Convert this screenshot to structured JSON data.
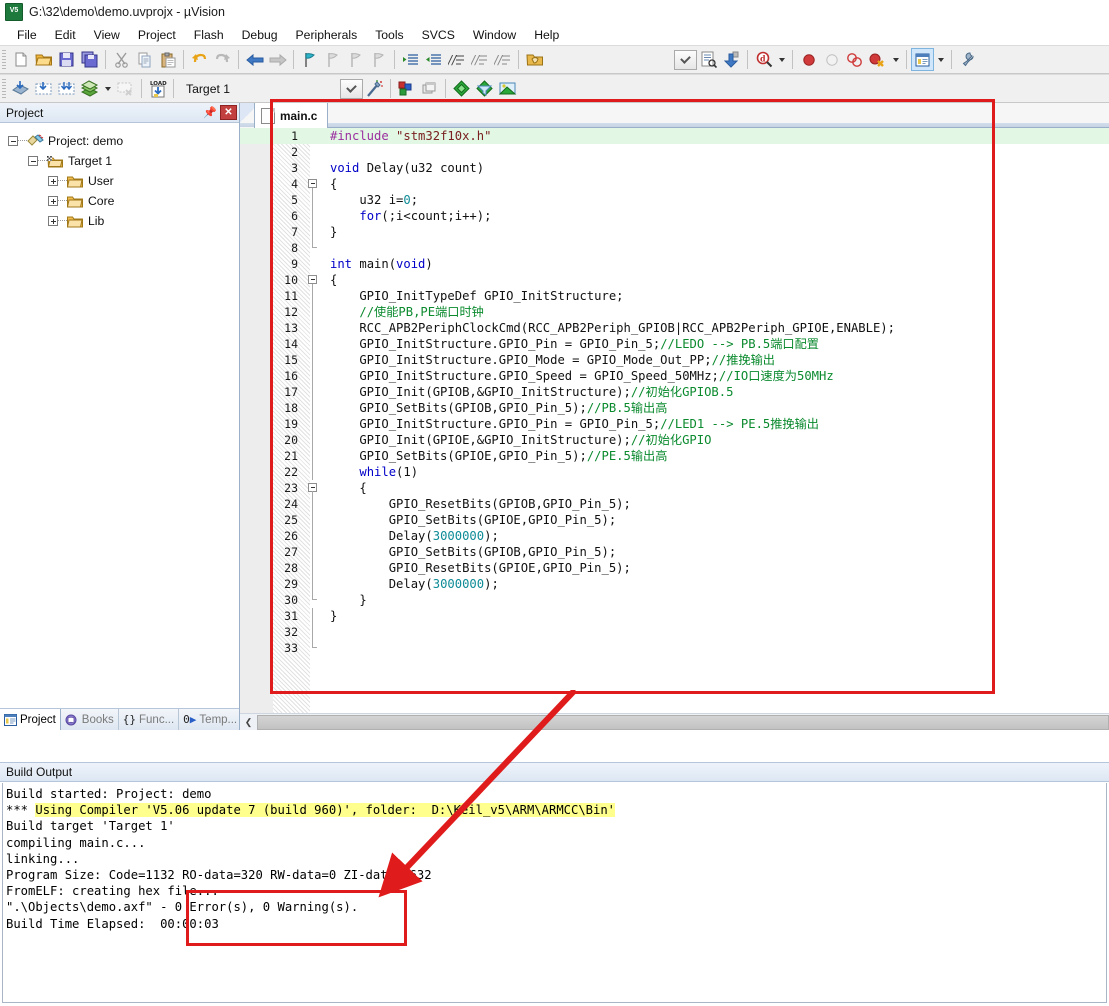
{
  "window": {
    "title": "G:\\32\\demo\\demo.uvprojx - µVision",
    "app_icon": "keil-uvision-icon"
  },
  "menubar": {
    "items": [
      "File",
      "Edit",
      "View",
      "Project",
      "Flash",
      "Debug",
      "Peripherals",
      "Tools",
      "SVCS",
      "Window",
      "Help"
    ]
  },
  "toolbar_row1": {
    "buttons": [
      {
        "name": "new-file-button",
        "icon": "new-document-icon"
      },
      {
        "name": "open-file-button",
        "icon": "open-folder-icon"
      },
      {
        "name": "save-button",
        "icon": "floppy-disk-icon"
      },
      {
        "name": "save-all-button",
        "icon": "save-all-icon"
      },
      {
        "name": "cut-button",
        "icon": "scissors-icon"
      },
      {
        "name": "copy-button",
        "icon": "copy-icon"
      },
      {
        "name": "paste-button",
        "icon": "clipboard-paste-icon"
      },
      {
        "name": "undo-button",
        "icon": "undo-arrow-icon"
      },
      {
        "name": "redo-button",
        "icon": "redo-arrow-icon"
      },
      {
        "name": "navigate-back-button",
        "icon": "arrow-left-icon"
      },
      {
        "name": "navigate-forward-button",
        "icon": "arrow-right-icon"
      },
      {
        "name": "toggle-bookmark-button",
        "icon": "bookmark-flag-icon"
      },
      {
        "name": "prev-bookmark-button",
        "icon": "bookmark-prev-icon"
      },
      {
        "name": "next-bookmark-button",
        "icon": "bookmark-next-icon"
      },
      {
        "name": "clear-bookmarks-button",
        "icon": "bookmark-clear-icon"
      },
      {
        "name": "indent-button",
        "icon": "indent-right-icon"
      },
      {
        "name": "outdent-button",
        "icon": "indent-left-icon"
      },
      {
        "name": "comment-button",
        "icon": "comment-lines-icon"
      },
      {
        "name": "uncomment-button",
        "icon": "uncomment-lines-icon"
      },
      {
        "name": "uncomment2-button",
        "icon": "uncomment-alt-icon"
      },
      {
        "name": "open-in-folder-button",
        "icon": "folder-hand-icon"
      },
      {
        "name": "config-combo-button",
        "icon": "chevron-down-icon"
      },
      {
        "name": "configure-debug-button",
        "icon": "document-settings-icon"
      },
      {
        "name": "download-button",
        "icon": "blue-down-arrow-icon"
      },
      {
        "name": "start-debug-button",
        "icon": "debug-magnifier-icon"
      },
      {
        "name": "start-debug-dropdown",
        "icon": "caret-down-icon"
      },
      {
        "name": "insert-breakpoint-button",
        "icon": "red-circle-icon"
      },
      {
        "name": "disable-breakpoint-button",
        "icon": "hollow-circle-icon"
      },
      {
        "name": "disable-all-breakpoints-button",
        "icon": "two-circles-icon"
      },
      {
        "name": "kill-all-breakpoints-button",
        "icon": "red-circle-x-icon"
      },
      {
        "name": "breakpoints-dropdown",
        "icon": "caret-down-icon"
      },
      {
        "name": "window-layout-button",
        "icon": "window-panes-icon"
      },
      {
        "name": "window-layout-dropdown",
        "icon": "caret-down-icon"
      },
      {
        "name": "configure-button",
        "icon": "wrench-icon"
      }
    ]
  },
  "toolbar_row2": {
    "buttons": [
      {
        "name": "translate-button",
        "icon": "translate-file-icon"
      },
      {
        "name": "build-button",
        "icon": "build-target-icon"
      },
      {
        "name": "rebuild-button",
        "icon": "rebuild-all-icon"
      },
      {
        "name": "batch-build-button",
        "icon": "batch-build-icon"
      },
      {
        "name": "batch-build-dropdown",
        "icon": "caret-down-icon"
      },
      {
        "name": "stop-build-button",
        "icon": "stop-build-icon"
      },
      {
        "name": "load-button",
        "icon": "load-download-icon"
      },
      {
        "name": "target-dropdown-button",
        "icon": "chevron-down-icon"
      },
      {
        "name": "target-options-button",
        "icon": "magic-wand-icon"
      },
      {
        "name": "manage-project-items-button",
        "icon": "project-items-icon"
      },
      {
        "name": "manage-multiproject-button",
        "icon": "multi-project-icon"
      },
      {
        "name": "pack-installer-button",
        "icon": "green-diamond-icon"
      },
      {
        "name": "manage-runtime-button",
        "icon": "filter-diamond-icon"
      },
      {
        "name": "select-software-packs-button",
        "icon": "packs-box-icon"
      }
    ],
    "target_label": "Target 1"
  },
  "project_panel": {
    "title": "Project",
    "pin_icon": "pin-icon",
    "close_icon": "close-x-icon",
    "tree": [
      {
        "label": "Project: demo",
        "icon": "project-root-icon",
        "depth": 0,
        "expander": "minus"
      },
      {
        "label": "Target 1",
        "icon": "target-icon",
        "depth": 1,
        "expander": "minus"
      },
      {
        "label": "User",
        "icon": "folder-icon",
        "depth": 2,
        "expander": "plus"
      },
      {
        "label": "Core",
        "icon": "folder-icon",
        "depth": 2,
        "expander": "plus"
      },
      {
        "label": "Lib",
        "icon": "folder-icon",
        "depth": 2,
        "expander": "plus"
      }
    ],
    "tabs": [
      {
        "label": "Project",
        "icon": "project-window-icon",
        "selected": true
      },
      {
        "label": "Books",
        "icon": "books-icon",
        "selected": false
      },
      {
        "label": "Func...",
        "icon": "functions-braces-icon",
        "selected": false
      },
      {
        "label": "Temp...",
        "icon": "templates-icon",
        "selected": false
      }
    ]
  },
  "editor": {
    "tab": {
      "label": "main.c",
      "icon": "c-file-icon"
    },
    "scroll_left_icon": "chevron-left-icon",
    "lines": [
      {
        "n": 1,
        "highlight": true,
        "fold": "none",
        "tokens": [
          {
            "t": "#include ",
            "c": "pp"
          },
          {
            "t": "\"stm32f10x.h\"",
            "c": "st"
          }
        ]
      },
      {
        "n": 2,
        "highlight": false,
        "fold": "none",
        "tokens": []
      },
      {
        "n": 3,
        "highlight": false,
        "fold": "none",
        "tokens": [
          {
            "t": "void",
            "c": "k"
          },
          {
            "t": " Delay(u32 count)",
            "c": "cn"
          }
        ]
      },
      {
        "n": 4,
        "highlight": false,
        "fold": "start",
        "tokens": [
          {
            "t": "{",
            "c": "cn"
          }
        ]
      },
      {
        "n": 5,
        "highlight": false,
        "fold": "mid",
        "tokens": [
          {
            "t": "    u32 i=",
            "c": "cn"
          },
          {
            "t": "0",
            "c": "nm"
          },
          {
            "t": ";",
            "c": "cn"
          }
        ]
      },
      {
        "n": 6,
        "highlight": false,
        "fold": "mid",
        "tokens": [
          {
            "t": "    ",
            "c": "cn"
          },
          {
            "t": "for",
            "c": "k"
          },
          {
            "t": "(;i<count;i++);",
            "c": "cn"
          }
        ]
      },
      {
        "n": 7,
        "highlight": false,
        "fold": "mid",
        "tokens": [
          {
            "t": "}",
            "c": "cn"
          }
        ]
      },
      {
        "n": 8,
        "highlight": false,
        "fold": "end",
        "tokens": []
      },
      {
        "n": 9,
        "highlight": false,
        "fold": "none",
        "tokens": [
          {
            "t": "int",
            "c": "k"
          },
          {
            "t": " main(",
            "c": "cn"
          },
          {
            "t": "void",
            "c": "k"
          },
          {
            "t": ")",
            "c": "cn"
          }
        ]
      },
      {
        "n": 10,
        "highlight": false,
        "fold": "start",
        "tokens": [
          {
            "t": "{",
            "c": "cn"
          }
        ]
      },
      {
        "n": 11,
        "highlight": false,
        "fold": "mid",
        "tokens": [
          {
            "t": "    GPIO_InitTypeDef GPIO_InitStructure;",
            "c": "cn"
          }
        ]
      },
      {
        "n": 12,
        "highlight": false,
        "fold": "mid",
        "tokens": [
          {
            "t": "    ",
            "c": "cn"
          },
          {
            "t": "//使能PB,PE端口时钟",
            "c": "cm"
          }
        ]
      },
      {
        "n": 13,
        "highlight": false,
        "fold": "mid",
        "tokens": [
          {
            "t": "    RCC_APB2PeriphClockCmd(RCC_APB2Periph_GPIOB|RCC_APB2Periph_GPIOE,ENABLE);",
            "c": "cn"
          }
        ]
      },
      {
        "n": 14,
        "highlight": false,
        "fold": "mid",
        "tokens": [
          {
            "t": "    GPIO_InitStructure.GPIO_Pin = GPIO_Pin_5;",
            "c": "cn"
          },
          {
            "t": "//LEDO --> PB.5端口配置",
            "c": "cm"
          }
        ]
      },
      {
        "n": 15,
        "highlight": false,
        "fold": "mid",
        "tokens": [
          {
            "t": "    GPIO_InitStructure.GPIO_Mode = GPIO_Mode_Out_PP;",
            "c": "cn"
          },
          {
            "t": "//推挽输出",
            "c": "cm"
          }
        ]
      },
      {
        "n": 16,
        "highlight": false,
        "fold": "mid",
        "tokens": [
          {
            "t": "    GPIO_InitStructure.GPIO_Speed = GPIO_Speed_50MHz;",
            "c": "cn"
          },
          {
            "t": "//IO口速度为50MHz",
            "c": "cm"
          }
        ]
      },
      {
        "n": 17,
        "highlight": false,
        "fold": "mid",
        "tokens": [
          {
            "t": "    GPIO_Init(GPIOB,&GPIO_InitStructure);",
            "c": "cn"
          },
          {
            "t": "//初始化GPIOB.5",
            "c": "cm"
          }
        ]
      },
      {
        "n": 18,
        "highlight": false,
        "fold": "mid",
        "tokens": [
          {
            "t": "    GPIO_SetBits(GPIOB,GPIO_Pin_5);",
            "c": "cn"
          },
          {
            "t": "//PB.5输出高",
            "c": "cm"
          }
        ]
      },
      {
        "n": 19,
        "highlight": false,
        "fold": "mid",
        "tokens": [
          {
            "t": "    GPIO_InitStructure.GPIO_Pin = GPIO_Pin_5;",
            "c": "cn"
          },
          {
            "t": "//LED1 --> PE.5推挽输出",
            "c": "cm"
          }
        ]
      },
      {
        "n": 20,
        "highlight": false,
        "fold": "mid",
        "tokens": [
          {
            "t": "    GPIO_Init(GPIOE,&GPIO_InitStructure);",
            "c": "cn"
          },
          {
            "t": "//初始化GPIO",
            "c": "cm"
          }
        ]
      },
      {
        "n": 21,
        "highlight": false,
        "fold": "mid",
        "tokens": [
          {
            "t": "    GPIO_SetBits(GPIOE,GPIO_Pin_5);",
            "c": "cn"
          },
          {
            "t": "//PE.5输出高",
            "c": "cm"
          }
        ]
      },
      {
        "n": 22,
        "highlight": false,
        "fold": "mid",
        "tokens": [
          {
            "t": "    ",
            "c": "cn"
          },
          {
            "t": "while",
            "c": "k"
          },
          {
            "t": "(1)",
            "c": "cn"
          }
        ]
      },
      {
        "n": 23,
        "highlight": false,
        "fold": "start2",
        "tokens": [
          {
            "t": "    {",
            "c": "cn"
          }
        ]
      },
      {
        "n": 24,
        "highlight": false,
        "fold": "mid2",
        "tokens": [
          {
            "t": "        GPIO_ResetBits(GPIOB,GPIO_Pin_5);",
            "c": "cn"
          }
        ]
      },
      {
        "n": 25,
        "highlight": false,
        "fold": "mid2",
        "tokens": [
          {
            "t": "        GPIO_SetBits(GPIOE,GPIO_Pin_5);",
            "c": "cn"
          }
        ]
      },
      {
        "n": 26,
        "highlight": false,
        "fold": "mid2",
        "tokens": [
          {
            "t": "        Delay(",
            "c": "cn"
          },
          {
            "t": "3000000",
            "c": "nm"
          },
          {
            "t": ");",
            "c": "cn"
          }
        ]
      },
      {
        "n": 27,
        "highlight": false,
        "fold": "mid2",
        "tokens": [
          {
            "t": "        GPIO_SetBits(GPIOB,GPIO_Pin_5);",
            "c": "cn"
          }
        ]
      },
      {
        "n": 28,
        "highlight": false,
        "fold": "mid2",
        "tokens": [
          {
            "t": "        GPIO_ResetBits(GPIOE,GPIO_Pin_5);",
            "c": "cn"
          }
        ]
      },
      {
        "n": 29,
        "highlight": false,
        "fold": "mid2",
        "tokens": [
          {
            "t": "        Delay(",
            "c": "cn"
          },
          {
            "t": "3000000",
            "c": "nm"
          },
          {
            "t": ");",
            "c": "cn"
          }
        ]
      },
      {
        "n": 30,
        "highlight": false,
        "fold": "end2",
        "tokens": [
          {
            "t": "    }",
            "c": "cn"
          }
        ]
      },
      {
        "n": 31,
        "highlight": false,
        "fold": "mid",
        "tokens": [
          {
            "t": "}",
            "c": "cn"
          }
        ]
      },
      {
        "n": 32,
        "highlight": false,
        "fold": "mid",
        "tokens": []
      },
      {
        "n": 33,
        "highlight": false,
        "fold": "end",
        "tokens": []
      }
    ]
  },
  "build_output": {
    "title": "Build Output",
    "lines": [
      {
        "segments": [
          {
            "t": "Build started: Project: demo",
            "hl": false
          }
        ]
      },
      {
        "segments": [
          {
            "t": "*** ",
            "hl": false
          },
          {
            "t": "Using Compiler 'V5.06 update 7 (build 960)', folder:  D:\\Keil_v5\\ARM\\ARMCC\\Bin'",
            "hl": true
          }
        ]
      },
      {
        "segments": [
          {
            "t": "Build target 'Target 1'",
            "hl": false
          }
        ]
      },
      {
        "segments": [
          {
            "t": "compiling main.c...",
            "hl": false
          }
        ]
      },
      {
        "segments": [
          {
            "t": "linking...",
            "hl": false
          }
        ]
      },
      {
        "segments": [
          {
            "t": "Program Size: Code=1132 RO-data=320 RW-data=0 ZI-data=1632",
            "hl": false
          }
        ]
      },
      {
        "segments": [
          {
            "t": "FromELF: creating hex file...",
            "hl": false
          }
        ]
      },
      {
        "segments": [
          {
            "t": "\".\\Objects\\demo.axf\" - 0 Error(s), 0 Warning(s).",
            "hl": false
          }
        ]
      },
      {
        "segments": [
          {
            "t": "Build Time Elapsed:  00:00:03",
            "hl": false
          }
        ]
      }
    ]
  },
  "annotations": {
    "color": "#e01b1b",
    "editor_box_name": "editor-highlight-box",
    "error_box_name": "build-result-highlight-box",
    "arrow_name": "annotation-arrow"
  }
}
